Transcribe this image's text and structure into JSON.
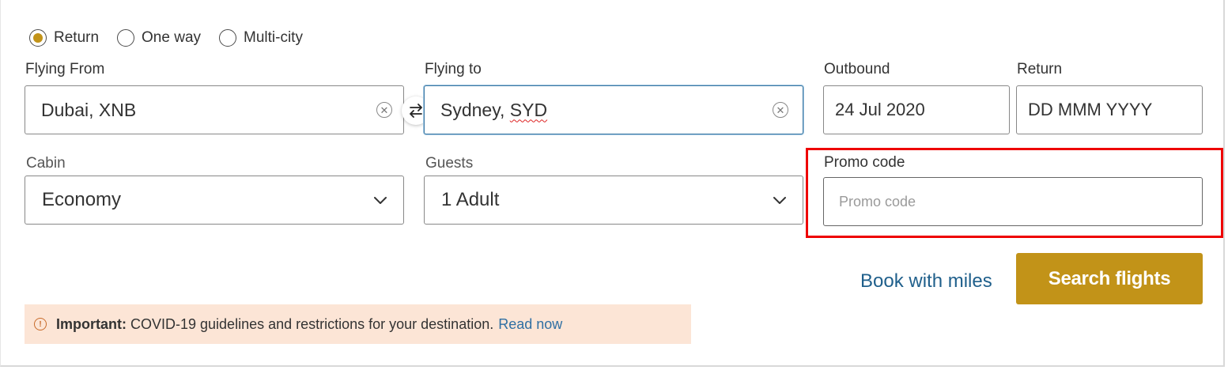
{
  "colors": {
    "accent": "#c29318",
    "link": "#1f5f8b",
    "notice_bg": "#fce5d6",
    "highlight": "#ee0000"
  },
  "trip_type": {
    "options": [
      {
        "label": "Return",
        "selected": true
      },
      {
        "label": "One way",
        "selected": false
      },
      {
        "label": "Multi-city",
        "selected": false
      }
    ]
  },
  "flying_from": {
    "label": "Flying From",
    "value": "Dubai, XNB",
    "icon": "clear-icon"
  },
  "flying_to": {
    "label": "Flying to",
    "value_city": "Sydney, ",
    "value_code": "SYD",
    "icon": "clear-icon"
  },
  "swap_icon": "swap-icon",
  "outbound": {
    "label": "Outbound",
    "value": "24 Jul 2020"
  },
  "return_date": {
    "label": "Return",
    "placeholder": "DD MMM YYYY"
  },
  "cabin": {
    "label": "Cabin",
    "value": "Economy",
    "icon": "chevron-down-icon"
  },
  "guests": {
    "label": "Guests",
    "value": "1 Adult",
    "icon": "chevron-down-icon"
  },
  "promo": {
    "label": "Promo code",
    "placeholder": "Promo code"
  },
  "actions": {
    "book_with_miles": "Book with miles",
    "search_flights": "Search flights"
  },
  "notice": {
    "icon": "info-icon",
    "important": "Important:",
    "text": "COVID-19 guidelines and restrictions for your destination.",
    "link": "Read now"
  }
}
